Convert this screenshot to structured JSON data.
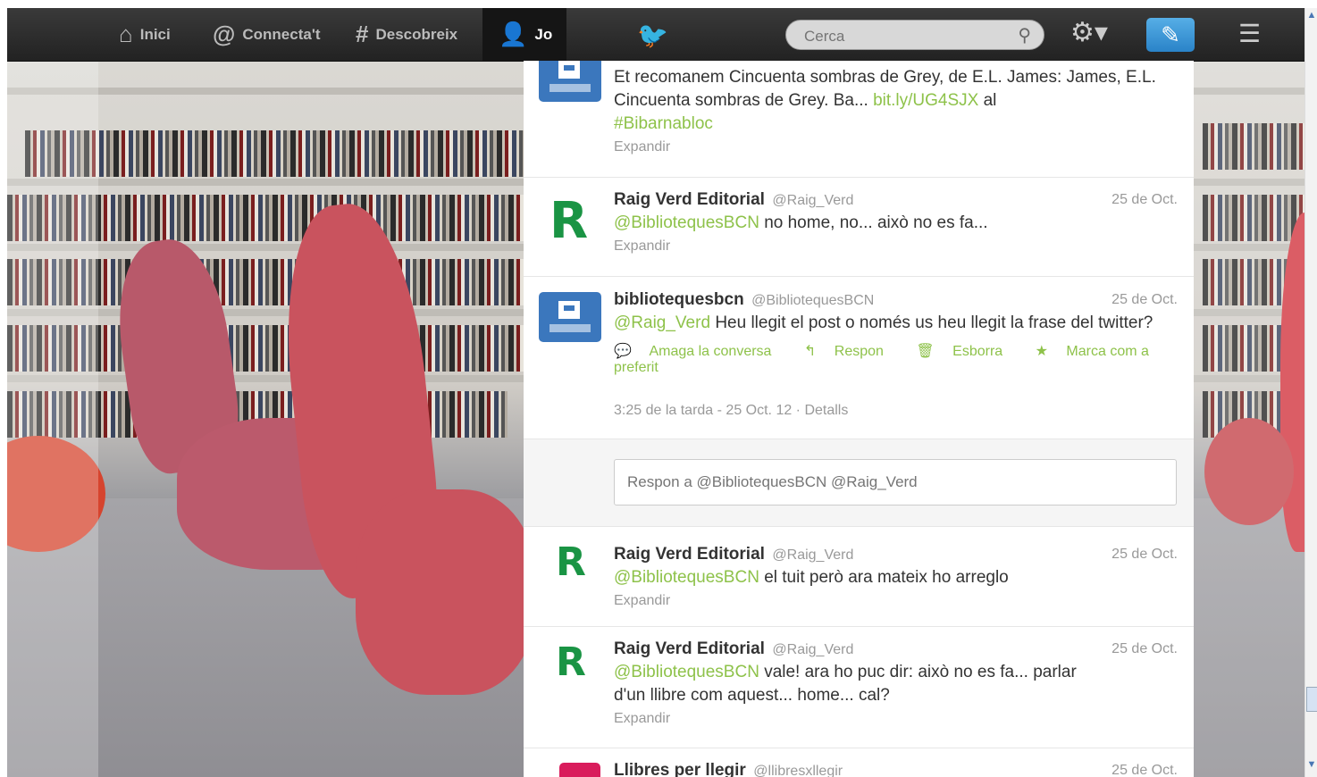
{
  "topbar": {
    "nav": [
      {
        "label": "Inici",
        "icon": "home-icon"
      },
      {
        "label": "Connecta't",
        "icon": "at-icon"
      },
      {
        "label": "Descobreix",
        "icon": "hash-icon"
      },
      {
        "label": "Jo",
        "icon": "user-icon"
      }
    ],
    "search_placeholder": "Cerca",
    "accent": "#2a83c8"
  },
  "tweets": [
    {
      "name": "",
      "handle": "",
      "date": "",
      "text": "Et recomanem Cincuenta sombras de Grey, de E.L. James: James, E.L. Cincuenta sombras de Grey. Ba...",
      "link": "bit.ly/UG4SJX",
      "text_after": "al",
      "hashtag": "#Bibarnabloc",
      "expand": "Expandir"
    },
    {
      "name": "Raig Verd Editorial",
      "handle": "@Raig_Verd",
      "date": "25 de Oct.",
      "mention": "@BibliotequesBCN",
      "text": "no home, no... això no es fa...",
      "expand": "Expandir"
    },
    {
      "name": "bibliotequesbcn",
      "handle": "@BibliotequesBCN",
      "date": "25 de Oct.",
      "mention": "@Raig_Verd",
      "text": "Heu llegit el post o només us heu llegit la frase del twitter?",
      "actions": [
        "Amaga la conversa",
        "Respon",
        "Esborra",
        "Marca com a preferit"
      ],
      "meta": "3:25 de la tarda - 25 Oct. 12 · Detalls"
    },
    {
      "name": "Raig Verd Editorial",
      "handle": "@Raig_Verd",
      "date": "25 de Oct.",
      "mention": "@BibliotequesBCN",
      "text": "el tuit però ara mateix ho arreglo",
      "expand": "Expandir"
    },
    {
      "name": "Raig Verd Editorial",
      "handle": "@Raig_Verd",
      "date": "25 de Oct.",
      "mention": "@BibliotequesBCN",
      "text": "vale! ara ho puc dir: això no es fa... parlar d'un llibre com aquest... home... cal?",
      "expand": "Expandir"
    },
    {
      "name": "Llibres per llegir",
      "handle": "@llibresxllegir",
      "date": "25 de Oct."
    }
  ],
  "reply": {
    "placeholder": "Respon a @BibliotequesBCN @Raig_Verd"
  }
}
